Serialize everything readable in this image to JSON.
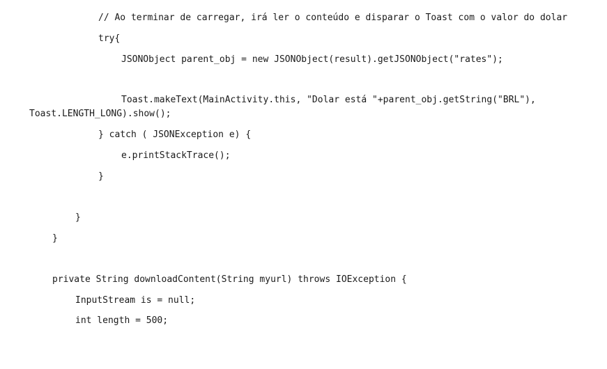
{
  "document": {
    "lines": [
      "// Ao terminar de carregar, irá ler o conteúdo e disparar o Toast com o valor do dolar",
      "try{",
      "JSONObject parent_obj = new JSONObject(result).getJSONObject(\"rates\");",
      "Toast.makeText(MainActivity.this, \"Dolar está \"+parent_obj.getString(\"BRL\"),",
      "Toast.LENGTH_LONG).show();",
      "} catch ( JSONException e) {",
      "e.printStackTrace();",
      "}",
      "}",
      "}",
      "private String downloadContent(String myurl) throws IOException {",
      "InputStream is = null;",
      "int length = 500;"
    ]
  }
}
